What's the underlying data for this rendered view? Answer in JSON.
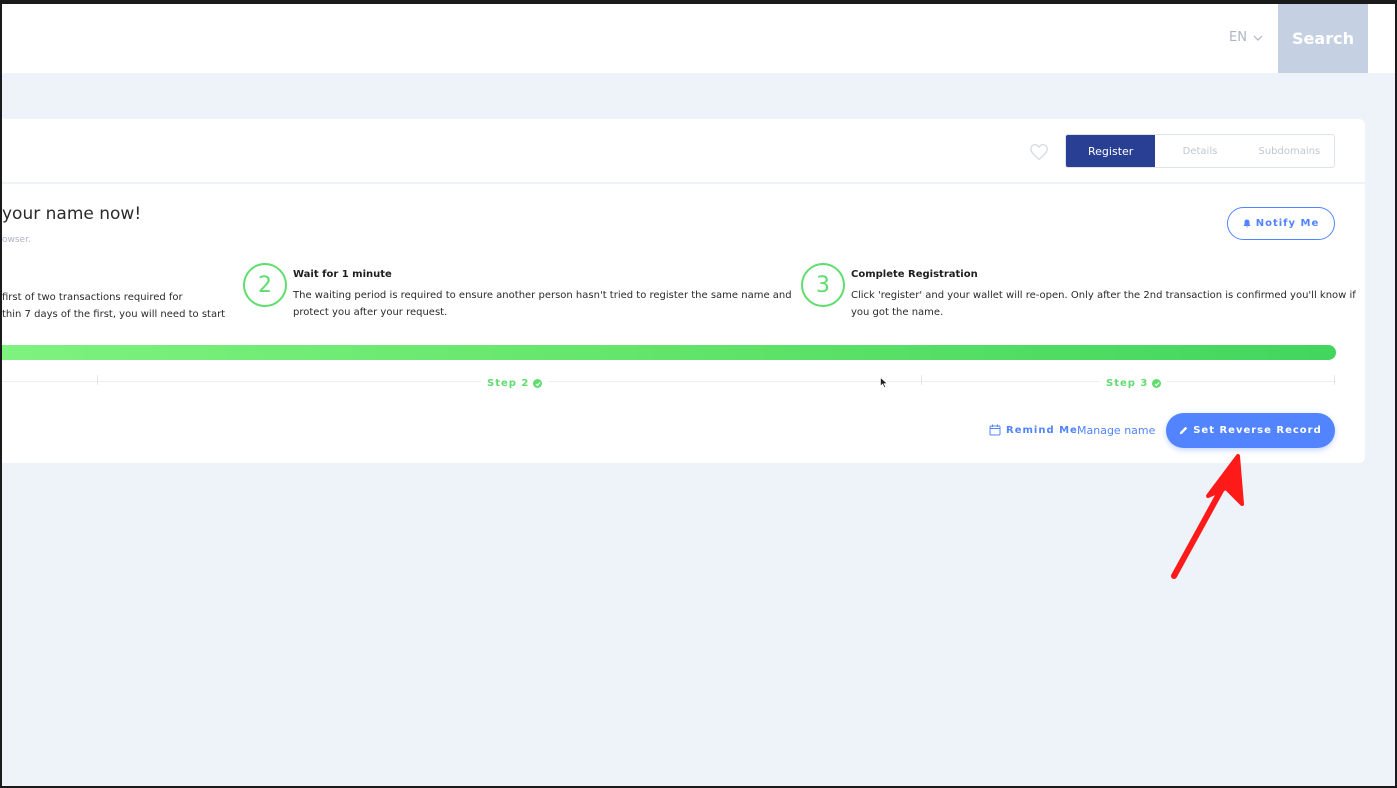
{
  "header": {
    "language": "EN",
    "search_label": "Search"
  },
  "tabs": [
    {
      "label": "Register"
    },
    {
      "label": "Details"
    },
    {
      "label": "Subdomains"
    }
  ],
  "registration": {
    "headline": "your name now!",
    "subtext": "owser.",
    "notify_label": "Notify Me",
    "step1": {
      "line1": "first of two transactions required for",
      "line2": "thin 7 days of the first, you will need to start"
    },
    "step2": {
      "number": "2",
      "title": "Wait for 1 minute",
      "line1": "The waiting period is required to ensure another person hasn't tried to register the same name and",
      "line2": "protect you after your request."
    },
    "step3": {
      "number": "3",
      "title": "Complete Registration",
      "line1": "Click 'register' and your wallet will re-open. Only after the 2nd transaction is confirmed you'll know if",
      "line2": "you got the name."
    },
    "progress_labels": [
      "Step 2",
      "Step 3"
    ],
    "progress": 1.0
  },
  "actions": {
    "remind_label": "Remind Me",
    "manage_label": "Manage name",
    "reverse_label": "Set Reverse Record"
  },
  "colors": {
    "primary": "#5284ff",
    "tab_active": "#283f93",
    "success": "#5fdd6e",
    "annotation_arrow": "#ff1a1a"
  }
}
